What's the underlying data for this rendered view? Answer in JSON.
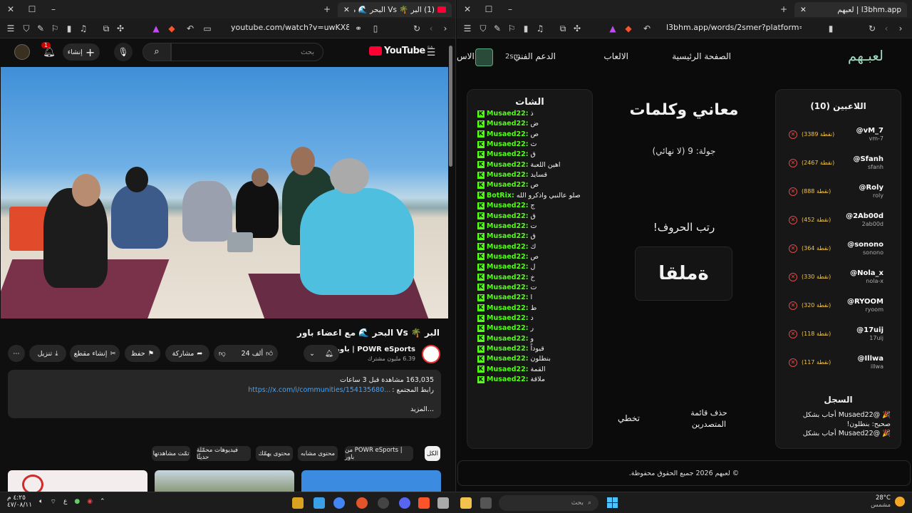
{
  "left_window": {
    "tab_title": "(1) البر 🌴 Vs البحر 🌊 مع اعضا",
    "url": "youtube.com/watch?v=uwKX81WsQng",
    "youtube": {
      "logo": "YouTube",
      "logo_region": "SA",
      "search_placeholder": "بحث",
      "create_label": "إنشاء",
      "notification_count": "1",
      "video_title": "البر 🌴 Vs البحر 🌊 مع اعضاء باور",
      "channel_name": "POWR eSports | باور",
      "subscribers": "6.39 مليون مشترك",
      "likes": "24 ألف",
      "share_label": "مشاركة",
      "save_label": "حفظ",
      "clip_label": "إنشاء مقطع",
      "download_label": "تنزيل",
      "views_time": "163,035 مشاهدة قبل 3 ساعات",
      "community_label": "رابط المجتمع :",
      "community_link": "https://x.com/i/communities/154135680...",
      "more_label": "...المزيد",
      "chips": [
        "الكل",
        "من POWR eSports | باور",
        "محتوى مشابه",
        "محتوى يهمّك",
        "فيديوهات محمّلة حديثًا",
        "تمّت مشاهدتها"
      ]
    }
  },
  "right_window": {
    "tab_title": "لعبهم | l3bhm.app",
    "url": "l3bhm.app/words/2smer?platform=kick",
    "logo": "لعبـهم",
    "nav": [
      "الصفحة الرئيسية",
      "الالعاب",
      "الدعم الفني",
      "الاس"
    ],
    "user_tag": "2sm",
    "players_title": "اللاعبين (10)",
    "players": [
      {
        "name": "@vM_7",
        "user": "vm-7",
        "points": "(3389 نقطة)"
      },
      {
        "name": "@Sfanh",
        "user": "sfanh",
        "points": "(2467 نقطة)"
      },
      {
        "name": "@Roly",
        "user": "roly",
        "points": "(888 نقطة)"
      },
      {
        "name": "@2Ab00d",
        "user": "2ab00d",
        "points": "(452 نقطة)"
      },
      {
        "name": "@sonono",
        "user": "sonono",
        "points": "(364 نقطة)"
      },
      {
        "name": "@Nola_x",
        "user": "nola-x",
        "points": "(330 نقطة)"
      },
      {
        "name": "@RYOOM",
        "user": "ryoom",
        "points": "(320 نقطة)"
      },
      {
        "name": "@17uij",
        "user": "17uij",
        "points": "(118 نقطة)"
      },
      {
        "name": "@Illwa",
        "user": "illwa",
        "points": "(117 نقطة)"
      }
    ],
    "game_title": "معاني وكلمات",
    "round": "جولة: 9 (لا نهائي)",
    "prompt": "رتب الحروف!",
    "letters": "ةملقا",
    "skip_label": "تخطي",
    "clear_label": "حذف قائمة المتصدرين",
    "chat_title": "الشات",
    "chat": [
      {
        "user": "Musaed22:",
        "msg": "ذ"
      },
      {
        "user": "Musaed22:",
        "msg": "ض"
      },
      {
        "user": "Musaed22:",
        "msg": "ص"
      },
      {
        "user": "Musaed22:",
        "msg": "ث"
      },
      {
        "user": "Musaed22:",
        "msg": "ق"
      },
      {
        "user": "Musaed22:",
        "msg": "اهين اللعبة"
      },
      {
        "user": "Musaed22:",
        "msg": "قسايد"
      },
      {
        "user": "Musaed22:",
        "msg": "ص"
      },
      {
        "user": "BotRix:",
        "msg": "صلو عالنبي واذكرو الله"
      },
      {
        "user": "Musaed22:",
        "msg": "ج"
      },
      {
        "user": "Musaed22:",
        "msg": "ق"
      },
      {
        "user": "Musaed22:",
        "msg": "ت"
      },
      {
        "user": "Musaed22:",
        "msg": "ق"
      },
      {
        "user": "Musaed22:",
        "msg": "ك"
      },
      {
        "user": "Musaed22:",
        "msg": "ص"
      },
      {
        "user": "Musaed22:",
        "msg": "ل"
      },
      {
        "user": "Musaed22:",
        "msg": "خ"
      },
      {
        "user": "Musaed22:",
        "msg": "ت"
      },
      {
        "user": "Musaed22:",
        "msg": "ا"
      },
      {
        "user": "Musaed22:",
        "msg": "ط"
      },
      {
        "user": "Musaed22:",
        "msg": "د"
      },
      {
        "user": "Musaed22:",
        "msg": "ر"
      },
      {
        "user": "Musaed22:",
        "msg": "و"
      },
      {
        "user": "Musaed22:",
        "msg": "قيوداً"
      },
      {
        "user": "Musaed22:",
        "msg": "بنطلون"
      },
      {
        "user": "Musaed22:",
        "msg": "القمة"
      },
      {
        "user": "Musaed22:",
        "msg": "ملاقة"
      }
    ],
    "log_title": "السجل",
    "log": [
      "🎉 @Musaed22 أجاب بشكل",
      "صحيح: بنطلون!",
      "🎉 @Musaed22 أجاب بشكل"
    ],
    "footer": "© لعبهم 2026 جميع الحقوق محفوظة."
  },
  "taskbar": {
    "search_placeholder": "بحث",
    "weather_temp": "28°C",
    "weather_desc": "مشمس",
    "time": "٤:٢٥ م",
    "date": "٤٧/٠٨/١١",
    "lang": "ع"
  },
  "colors": {
    "kick_green": "#53fc18",
    "youtube_red": "#ff0033",
    "points_yellow": "#f5c542"
  }
}
